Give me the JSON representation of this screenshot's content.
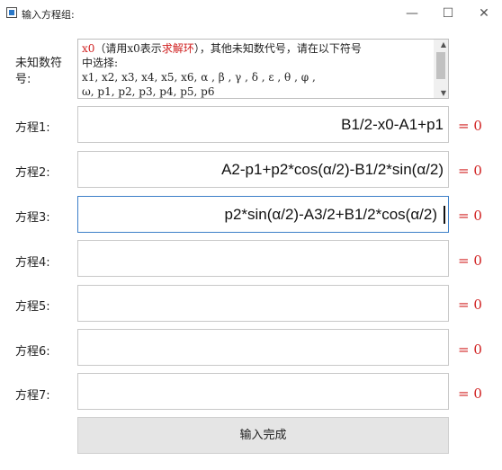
{
  "window": {
    "title": "输入方程组:"
  },
  "unknowns": {
    "label": "未知数符号:",
    "line1_prefix": "x0",
    "line1_mid": "（请用x0表示",
    "line1_red": "求解环",
    "line1_suffix": "），其他未知数代号，请在以下符号",
    "line2": "中选择:",
    "line3": "x1, x2, x3, x4, x5, x6, α ,  β ,  γ ,  δ ,  ε ,  θ ,  φ ,",
    "line4": "ω, p1, p2, p3, p4, p5, p6"
  },
  "equations": [
    {
      "label": "方程1:",
      "value": "B1/2-x0-A1+p1",
      "equals": "= 0"
    },
    {
      "label": "方程2:",
      "value": "A2-p1+p2*cos(α/2)-B1/2*sin(α/2)",
      "equals": "= 0"
    },
    {
      "label": "方程3:",
      "value": "p2*sin(α/2)-A3/2+B1/2*cos(α/2)",
      "equals": "= 0"
    },
    {
      "label": "方程4:",
      "value": "",
      "equals": "= 0"
    },
    {
      "label": "方程5:",
      "value": "",
      "equals": "= 0"
    },
    {
      "label": "方程6:",
      "value": "",
      "equals": "= 0"
    },
    {
      "label": "方程7:",
      "value": "",
      "equals": "= 0"
    }
  ],
  "submit_label": "输入完成"
}
